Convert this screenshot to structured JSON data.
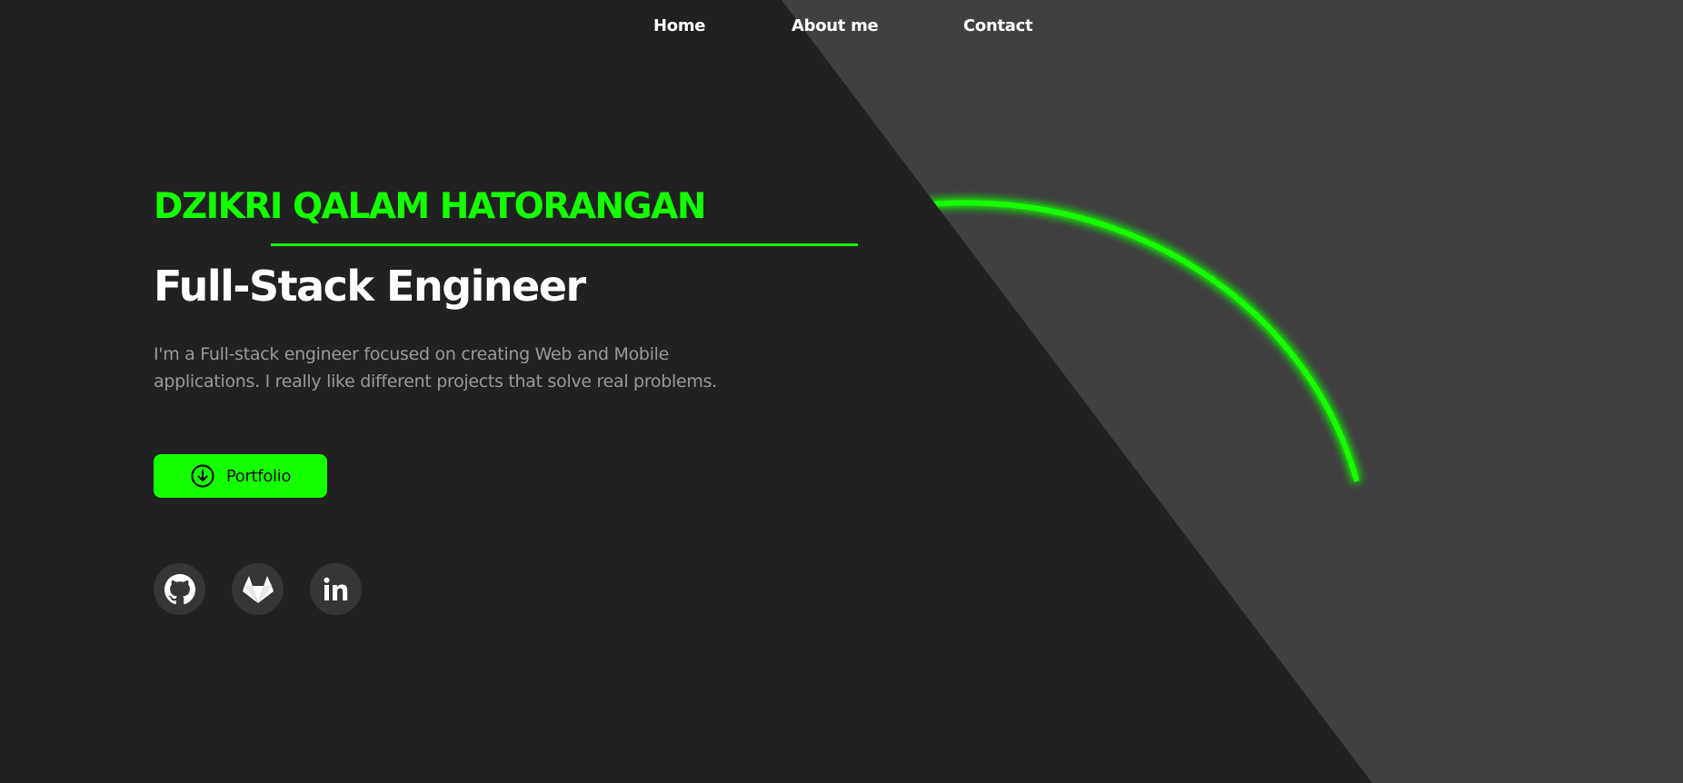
{
  "nav": {
    "items": [
      {
        "label": "Home"
      },
      {
        "label": "About me"
      },
      {
        "label": "Contact"
      }
    ]
  },
  "hero": {
    "name": "DZIKRI QALAM HATORANGAN",
    "role": "Full-Stack Engineer",
    "bio": "I'm a Full-stack engineer focused on creating Web and Mobile applications. I really like different projects that solve real problems.",
    "cta": {
      "label": "Portfolio",
      "icon": "arrow-down-circle-icon"
    }
  },
  "socials": [
    {
      "icon": "github-icon"
    },
    {
      "icon": "gitlab-icon"
    },
    {
      "icon": "linkedin-icon"
    }
  ],
  "colors": {
    "background": "#212121",
    "panel": "#404040",
    "accent": "#14ff00",
    "text": "#ffffff",
    "muted": "#9a9a9a",
    "social_bg": "#363636"
  }
}
